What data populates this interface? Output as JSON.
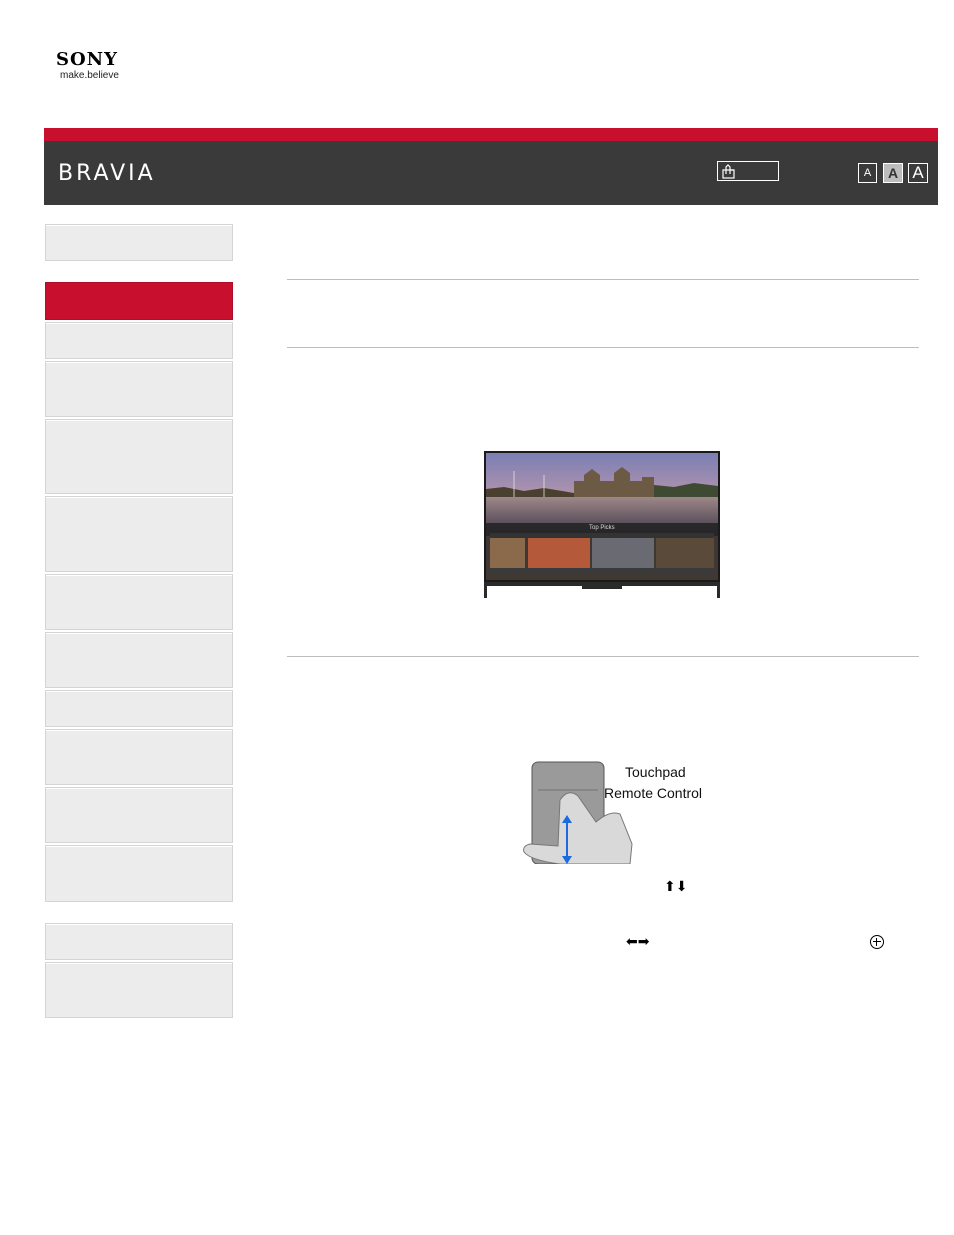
{
  "brand": {
    "name": "SONY",
    "tagline": "make.believe"
  },
  "header": {
    "title": "BRAVIA"
  },
  "font_size_buttons": [
    "A",
    "A",
    "A"
  ],
  "figures": {
    "tv": {
      "overlay_label": "Top Picks"
    },
    "touchpad": {
      "line1": "Touchpad",
      "line2": "Remote Control"
    }
  },
  "glyphs": {
    "up_down": "⬆⬇",
    "left_right": "⬅➡"
  },
  "colors": {
    "accent_red": "#c8102e",
    "header_bg": "#3a3a3a"
  }
}
